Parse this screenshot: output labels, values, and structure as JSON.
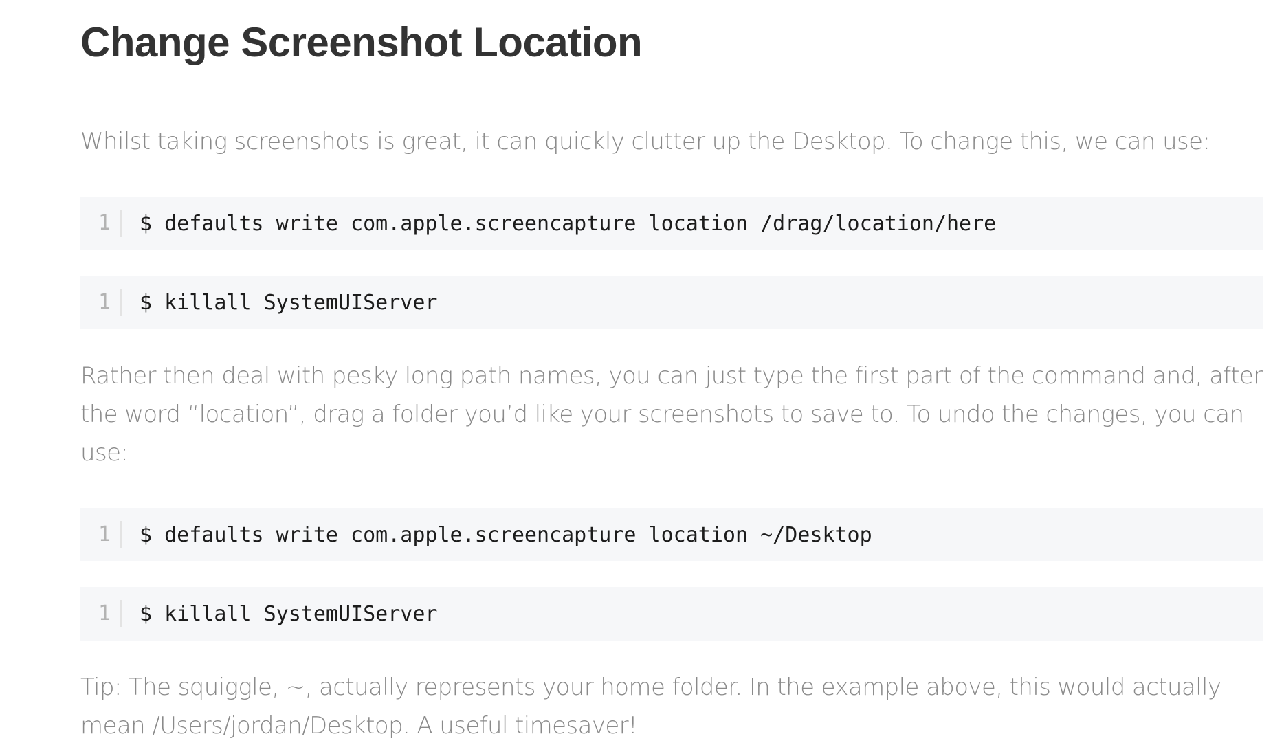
{
  "article": {
    "title": "Change Screenshot Location",
    "intro": "Whilst taking screenshots is great, it can quickly clutter up the Desktop. To change this, we can use:",
    "code_blocks_set": [
      {
        "line": "1",
        "command": "$ defaults write com.apple.screencapture location /drag/location/here"
      },
      {
        "line": "1",
        "command": "$ killall SystemUIServer"
      }
    ],
    "middle": "Rather then deal with pesky long path names, you can just type the first part of the command and, after the word “location”, drag a folder you’d like your screenshots to save to. To undo the changes, you can use:",
    "code_blocks_undo": [
      {
        "line": "1",
        "command": "$ defaults write com.apple.screencapture location ~/Desktop"
      },
      {
        "line": "1",
        "command": "$ killall SystemUIServer"
      }
    ],
    "tip": "Tip: The squiggle, ~, actually represents your home folder. In the example above, this would actually mean /Users/jordan/Desktop. A useful timesaver!"
  }
}
